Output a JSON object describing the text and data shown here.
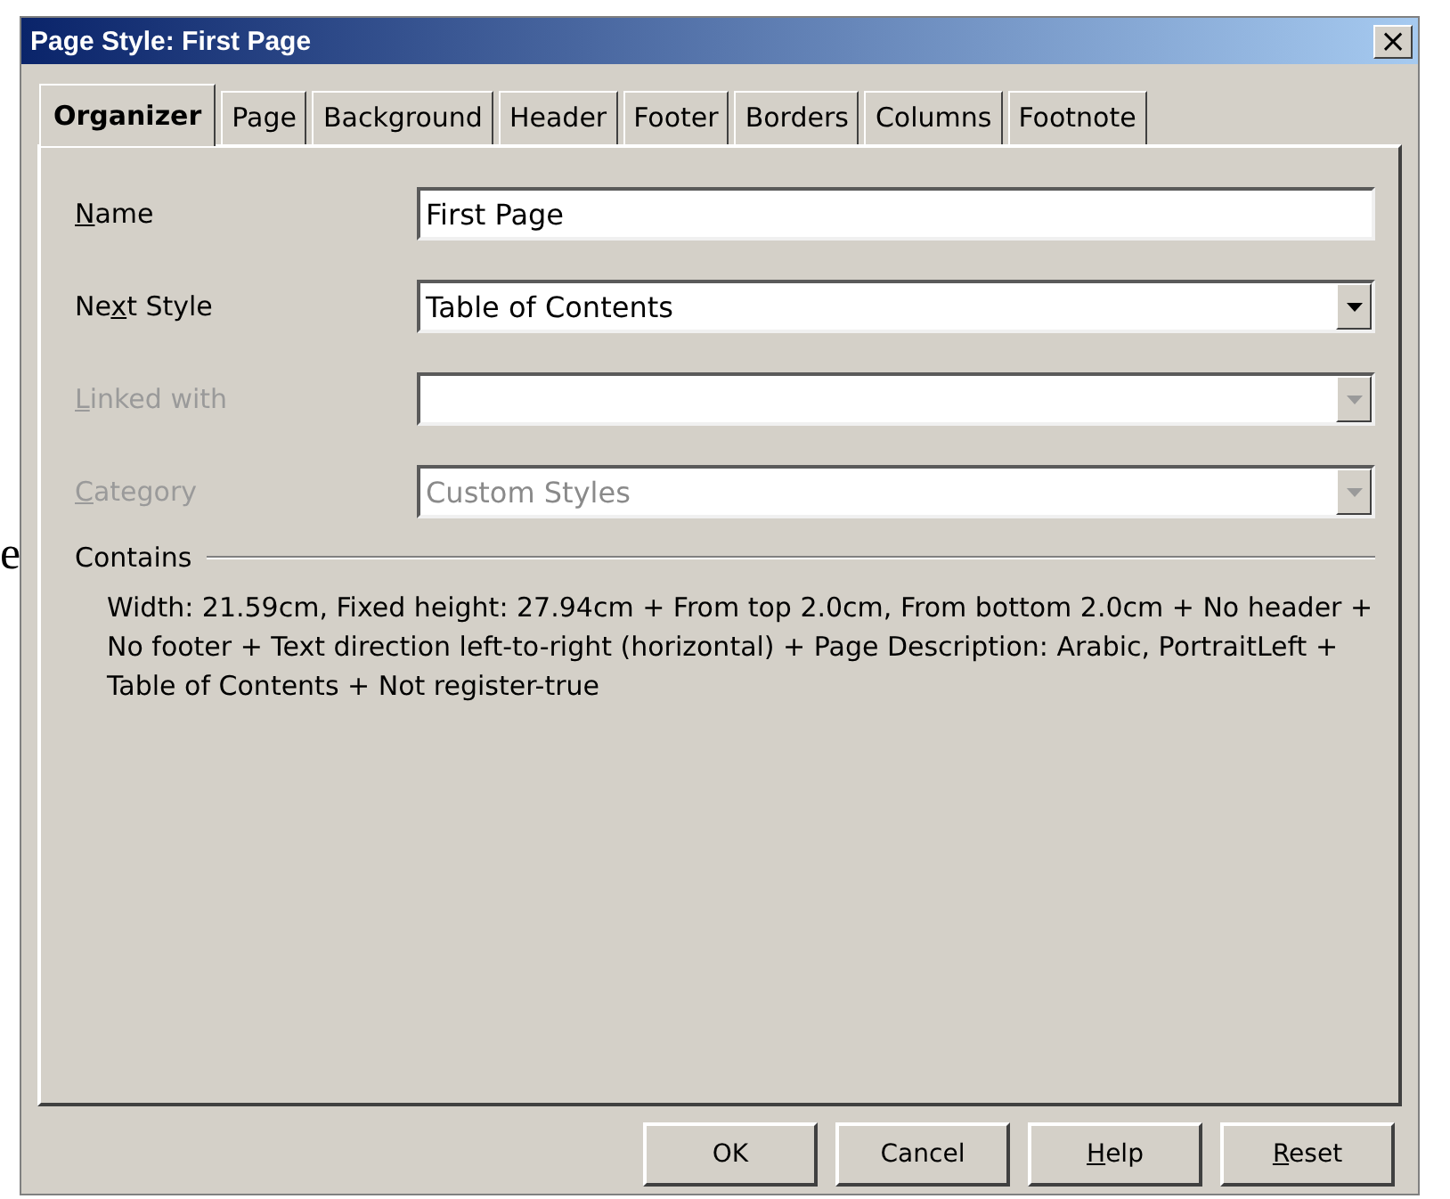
{
  "background_text": "e",
  "window": {
    "title": "Page Style: First Page",
    "close": "×"
  },
  "tabs": [
    {
      "label": "Organizer",
      "selected": true
    },
    {
      "label": "Page",
      "selected": false
    },
    {
      "label": "Background",
      "selected": false
    },
    {
      "label": "Header",
      "selected": false
    },
    {
      "label": "Footer",
      "selected": false
    },
    {
      "label": "Borders",
      "selected": false
    },
    {
      "label": "Columns",
      "selected": false
    },
    {
      "label": "Footnote",
      "selected": false
    }
  ],
  "fields": [
    {
      "kind": "text",
      "label": {
        "key": "N",
        "post": "ame"
      },
      "value": "First Page",
      "disabled": false
    },
    {
      "kind": "dropdown",
      "label": {
        "pre": "Ne",
        "key": "x",
        "post": "t Style"
      },
      "value": "Table of Contents",
      "disabled": false
    },
    {
      "kind": "dropdown",
      "label": {
        "key": "L",
        "post": "inked with"
      },
      "disabled": true
    },
    {
      "kind": "dropdown",
      "label": {
        "key": "C",
        "post": "ategory"
      },
      "value": "Custom Styles",
      "disabled": true
    }
  ],
  "contains": {
    "heading": "Contains",
    "text": "Width: 21.59cm, Fixed height: 27.94cm + From top 2.0cm, From bottom 2.0cm + No header + No footer + Text direction left-to-right (horizontal) + Page Description: Arabic, PortraitLeft + Table of Contents + Not register-true"
  },
  "buttons": [
    {
      "label": {
        "pre": "OK"
      }
    },
    {
      "label": {
        "pre": "Cancel"
      }
    },
    {
      "label": {
        "key": "H",
        "post": "elp"
      }
    },
    {
      "label": {
        "key": "R",
        "post": "eset"
      }
    }
  ]
}
